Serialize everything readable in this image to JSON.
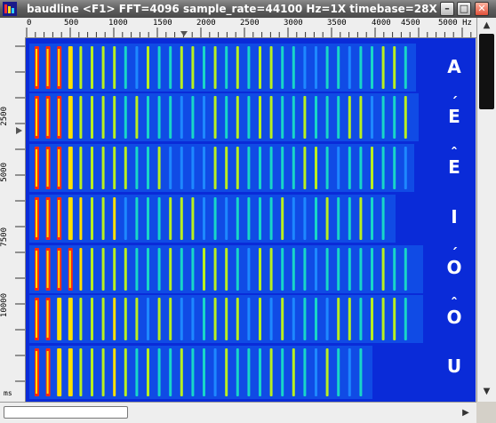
{
  "window": {
    "title": "baudline  <F1> FFT=4096 sample_rate=44100 Hz=1X timebase=28X  V"
  },
  "title_buttons": {
    "minimize": "–",
    "maximize": "□",
    "close": "✕"
  },
  "freq_ruler": {
    "labels": [
      "0",
      "500",
      "1000",
      "1500",
      "2000",
      "2500",
      "3000",
      "3500",
      "4000",
      "4500",
      "5000 Hz"
    ]
  },
  "time_ruler": {
    "labels": [
      "2500",
      "5000",
      "7500",
      "10000"
    ],
    "unit": "ms"
  },
  "vowels": [
    "A",
    "E",
    "E",
    "I",
    "O",
    "O",
    "U"
  ],
  "vowel_marks": [
    "",
    "´",
    "ˆ",
    "",
    "´",
    "ˆ",
    ""
  ],
  "colors": {
    "background": "#0a2bd8",
    "low": "#1e88ff",
    "mid": "#18d6c8",
    "high": "#b8f020",
    "peak": "#ff2a10",
    "hot": "#ffe000"
  },
  "scrollbars": {
    "up": "▲",
    "down": "▼",
    "left": "◀",
    "right": "▶"
  }
}
